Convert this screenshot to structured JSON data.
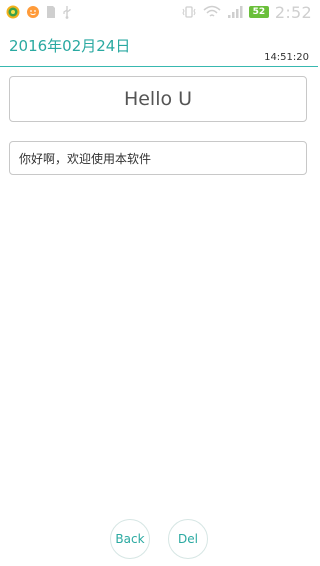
{
  "status_bar": {
    "icons": [
      "app-green-icon",
      "smiley-icon",
      "sim-card-icon",
      "usb-icon",
      "vibrate-icon",
      "wifi-icon",
      "signal-icon"
    ],
    "battery": "52",
    "clock": "2:52",
    "colors": {
      "battery": "#6abf3a",
      "icon": "#cfcfcf"
    }
  },
  "header": {
    "date": "2016年02月24日",
    "time": "14:51:20",
    "accent_color": "#2aa9a1"
  },
  "main": {
    "greeting": "Hello U",
    "message": "你好啊，欢迎使用本软件"
  },
  "buttons": {
    "back_label": "Back",
    "del_label": "Del"
  }
}
